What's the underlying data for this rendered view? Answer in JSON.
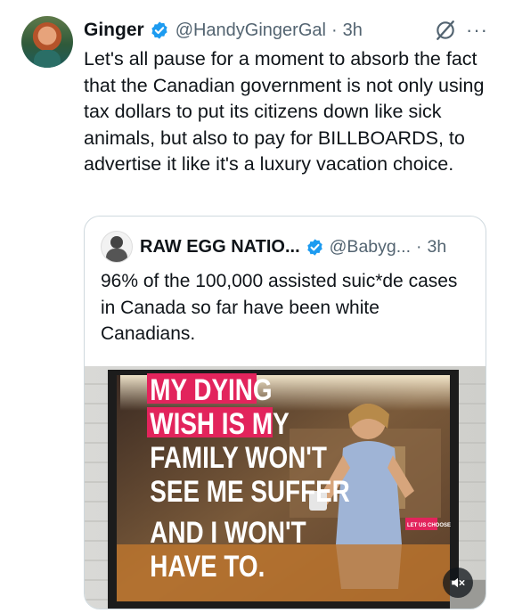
{
  "tweet": {
    "author_name": "Ginger",
    "handle": "@HandyGingerGal",
    "separator": "·",
    "time": "3h",
    "text": "Let's all pause for a moment to absorb the fact that the Canadian government is not only using tax dollars to put its citizens down like sick animals, but also to pay for BILLBOARDS, to advertise it like it's a luxury vacation choice.",
    "avatar_icon": "profile-avatar",
    "more_icon": "more-options-icon",
    "grok_icon": "grok-icon",
    "more_glyph": "···"
  },
  "quote": {
    "author_name": "RAW EGG NATIO...",
    "handle": "@Babyg...",
    "separator": "·",
    "time": "3h",
    "text": "96% of the 100,000 assisted suic*de cases in Canada so far have been white Canadians.",
    "image": {
      "billboard_lines": [
        "MY DYING",
        "WISH IS MY",
        "FAMILY WON'T",
        "SEE ME SUFFER",
        "AND I WON'T",
        "HAVE TO."
      ],
      "logo_text": "LET US CHOOSE"
    },
    "mute_icon": "speaker-muted-icon"
  },
  "colors": {
    "text": "#0f1419",
    "secondary": "#536471",
    "verified_blue": "#1d9bf0",
    "border": "#cfd9de",
    "billboard_red": "#e2245c"
  }
}
